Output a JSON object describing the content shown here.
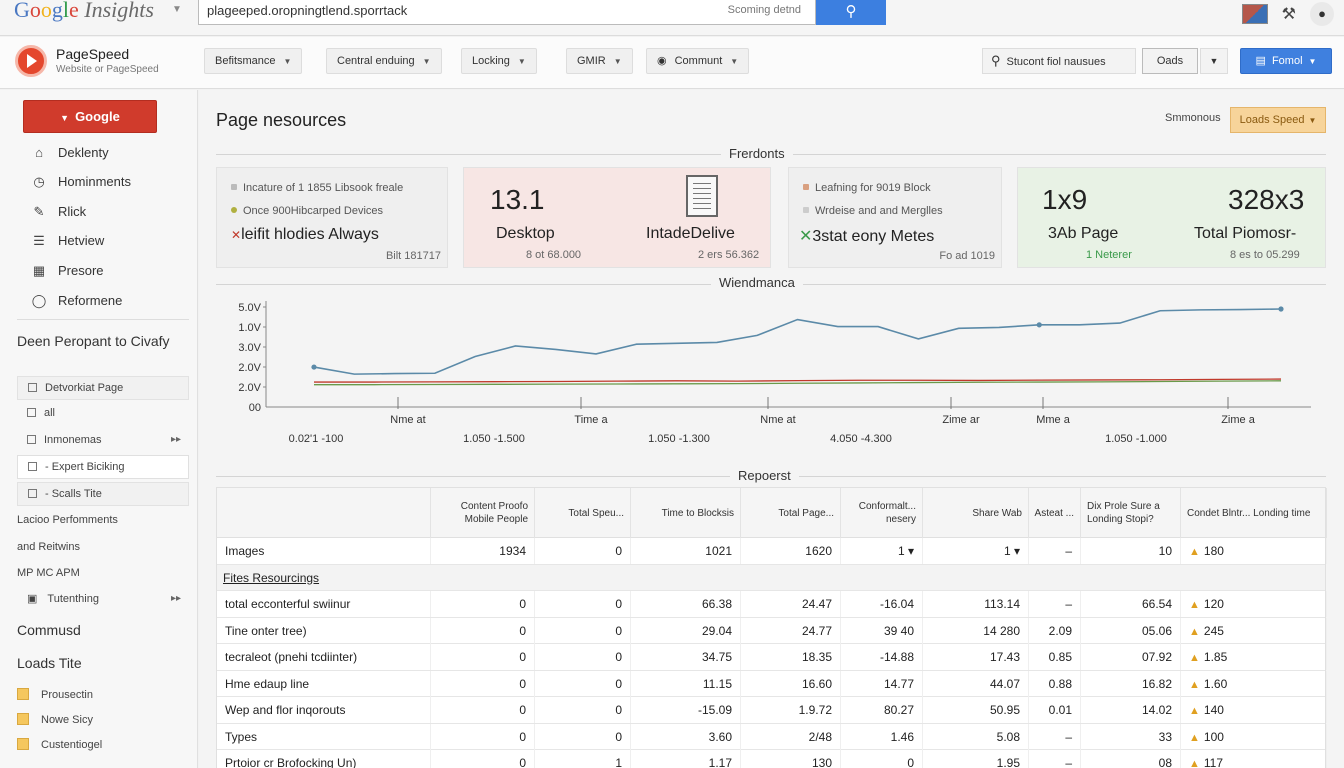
{
  "topbar": {
    "logo_parts": [
      "G",
      "o",
      "o",
      "g",
      "l",
      "e"
    ],
    "logo_suffix": " Insights",
    "search_query": "plageeped.oropningtlend.sporrtack",
    "search_hint": "Scoming detnd"
  },
  "appbar": {
    "title": "PageSpeed",
    "subtitle": "Website or PageSpeed",
    "menus": [
      "Befitsmance",
      "Central enduing",
      "Locking",
      "GMIR",
      "Communt"
    ],
    "search_label": "Stucont fiol nausues",
    "seg_label": "Oads",
    "primary_label": "Fomol"
  },
  "sidebar": {
    "primary": "Google",
    "nav": [
      {
        "label": "Deklenty",
        "icon": "building-icon"
      },
      {
        "label": "Hominments",
        "icon": "clock-icon"
      },
      {
        "label": "Rlick",
        "icon": "brush-icon"
      },
      {
        "label": "Hetview",
        "icon": "list-icon"
      },
      {
        "label": "Presore",
        "icon": "grid-icon"
      },
      {
        "label": "Reformene",
        "icon": "shield-icon"
      }
    ],
    "section1": "Deen Peropant to Civafy",
    "filters": [
      {
        "label": "Detvorkiat Page",
        "arrow": ""
      },
      {
        "label": "all",
        "arrow": ""
      },
      {
        "label": "Inmonemas",
        "arrow": "▸▸"
      },
      {
        "label": "- Expert Biciking",
        "arrow": ""
      },
      {
        "label": "- Scalls Tite",
        "arrow": ""
      }
    ],
    "plain": [
      "Lacioo Perfomments",
      "and Reitwins",
      "MP MC APM"
    ],
    "tutoring": "Tutenthing",
    "section2": "Commusd",
    "section3": "Loads Tite",
    "notes": [
      "Prousectin",
      "Nowe Sicy",
      "Custentiogel"
    ]
  },
  "main": {
    "title": "Page nesources",
    "sort_label": "Smmonous",
    "sort_value": "Loads Speed",
    "section_frontends": "Frerdonts",
    "section_chart": "Wiendmanca",
    "section_report": "Repoerst"
  },
  "cards": {
    "c1": {
      "line1": "Incature of 1 1855 Libsook freale",
      "line2": "Once 900Hibcarped Devices",
      "big": "leifit hlodies Always",
      "foot": "Bilt 181717"
    },
    "c2": {
      "num": "13.1",
      "left": "Desktop",
      "right": "IntadeDelive",
      "foot1": "8 ot 68.000",
      "foot2": "2 ers 56.362"
    },
    "c3": {
      "line1": "Leafning for 9019 Block",
      "line2": "Wrdeise and and Merglles",
      "big": "3stat eony Metes",
      "foot": "Fo ad 1019"
    },
    "c4": {
      "num1": "1x9",
      "num2": "328x3",
      "left": "3Ab Page",
      "right": "Total Piomosr-",
      "left_sub": "1 Neterer",
      "foot": "8 es to 05.299"
    }
  },
  "chart_data": {
    "type": "line",
    "y_ticks": [
      "5.0V",
      "1.0V",
      "3.0V",
      "2.0V",
      "2.0V",
      "00"
    ],
    "x_labels_top": [
      "Nme at",
      "Time a",
      "Nme at",
      "Zime ar",
      "Mme a",
      "Zime a"
    ],
    "x_labels_bottom": [
      "0.02'1 -100",
      "1.050 -1.500",
      "1.050 -1.300",
      "4.050 -4.300",
      "1.050 -1.000"
    ],
    "ylim": [
      0,
      5
    ],
    "x": [
      0,
      1,
      2,
      3,
      4,
      5,
      6,
      7,
      8,
      9,
      10,
      11,
      12,
      13,
      14,
      15,
      16,
      17,
      18,
      19,
      20,
      21
    ],
    "series": [
      {
        "color": "#5b8aa8",
        "values": [
          1.7,
          1.3,
          1.33,
          1.35,
          2.3,
          2.9,
          2.7,
          2.45,
          3.0,
          3.05,
          3.1,
          3.5,
          4.4,
          4.0,
          4.0,
          3.3,
          3.9,
          3.95,
          4.1,
          4.1,
          4.2,
          4.9,
          4.95,
          4.97,
          5.0
        ]
      },
      {
        "color": "#c0392b",
        "values": [
          0.85,
          0.85,
          0.86,
          0.87,
          0.88,
          0.9,
          0.92,
          0.9,
          0.93,
          0.95,
          0.95,
          0.94,
          0.96,
          0.97,
          0.98,
          1.0,
          1.02
        ]
      },
      {
        "color": "#6a9a4a",
        "values": [
          0.7,
          0.7,
          0.71,
          0.72,
          0.73,
          0.74,
          0.75,
          0.76,
          0.78,
          0.8,
          0.82,
          0.84,
          0.85,
          0.86,
          0.88,
          0.9,
          0.92
        ]
      }
    ]
  },
  "table": {
    "headers": [
      "",
      "Content Proofo Mobile People",
      "Total Speu...",
      "Time to Blocksis",
      "Total Page...",
      "Conformalt... nesery",
      "Share Wab",
      "Asteat ...",
      "Dix Prole Sure a Londing Stopi?",
      "Condet Blntr... Londing time"
    ],
    "rows": [
      {
        "type": "data",
        "cells": [
          "Images",
          "1934",
          "0",
          "1021",
          "1620",
          "1 ▾",
          "1 ▾",
          "–",
          "10",
          "180"
        ],
        "warn": true
      },
      {
        "type": "group",
        "cells": [
          "Fites Resourcings"
        ]
      },
      {
        "type": "data",
        "cells": [
          "total ecconterful swiinur",
          "0",
          "0",
          "66.38",
          "24.47",
          "-16.04",
          "113.14",
          "–",
          "66.54",
          "120"
        ],
        "warn": true
      },
      {
        "type": "data",
        "cells": [
          "Tine onter tree)",
          "0",
          "0",
          "29.04",
          "24.77",
          "39 40",
          "14 280",
          "2.09",
          "05.06",
          "245"
        ],
        "warn": true
      },
      {
        "type": "data",
        "cells": [
          "tecraleot (pnehi tcdiinter)",
          "0",
          "0",
          "34.75",
          "18.35",
          "-14.88",
          "17.43",
          "0.85",
          "07.92",
          "1.85"
        ],
        "warn": true
      },
      {
        "type": "data",
        "cells": [
          "Hme edaup line",
          "0",
          "0",
          "11.15",
          "16.60",
          "14.77",
          "44.07",
          "0.88",
          "16.82",
          "1.60"
        ],
        "warn": true
      },
      {
        "type": "data",
        "cells": [
          "Wep and flor inqorouts",
          "0",
          "0",
          "-15.09",
          "1.9.72",
          "80.27",
          "50.95",
          "0.01",
          "14.02",
          "140"
        ],
        "warn": true
      },
      {
        "type": "data",
        "cells": [
          "Types",
          "0",
          "0",
          "3.60",
          "2/48",
          "1.46",
          "5.08",
          "–",
          "33",
          "100"
        ],
        "warn": true
      },
      {
        "type": "data",
        "cells": [
          "Prtoior cr Brofocking Un)",
          "0",
          "1",
          "1.17",
          "130",
          "0",
          "1.95",
          "–",
          "08",
          "117"
        ],
        "warn": true
      }
    ]
  }
}
